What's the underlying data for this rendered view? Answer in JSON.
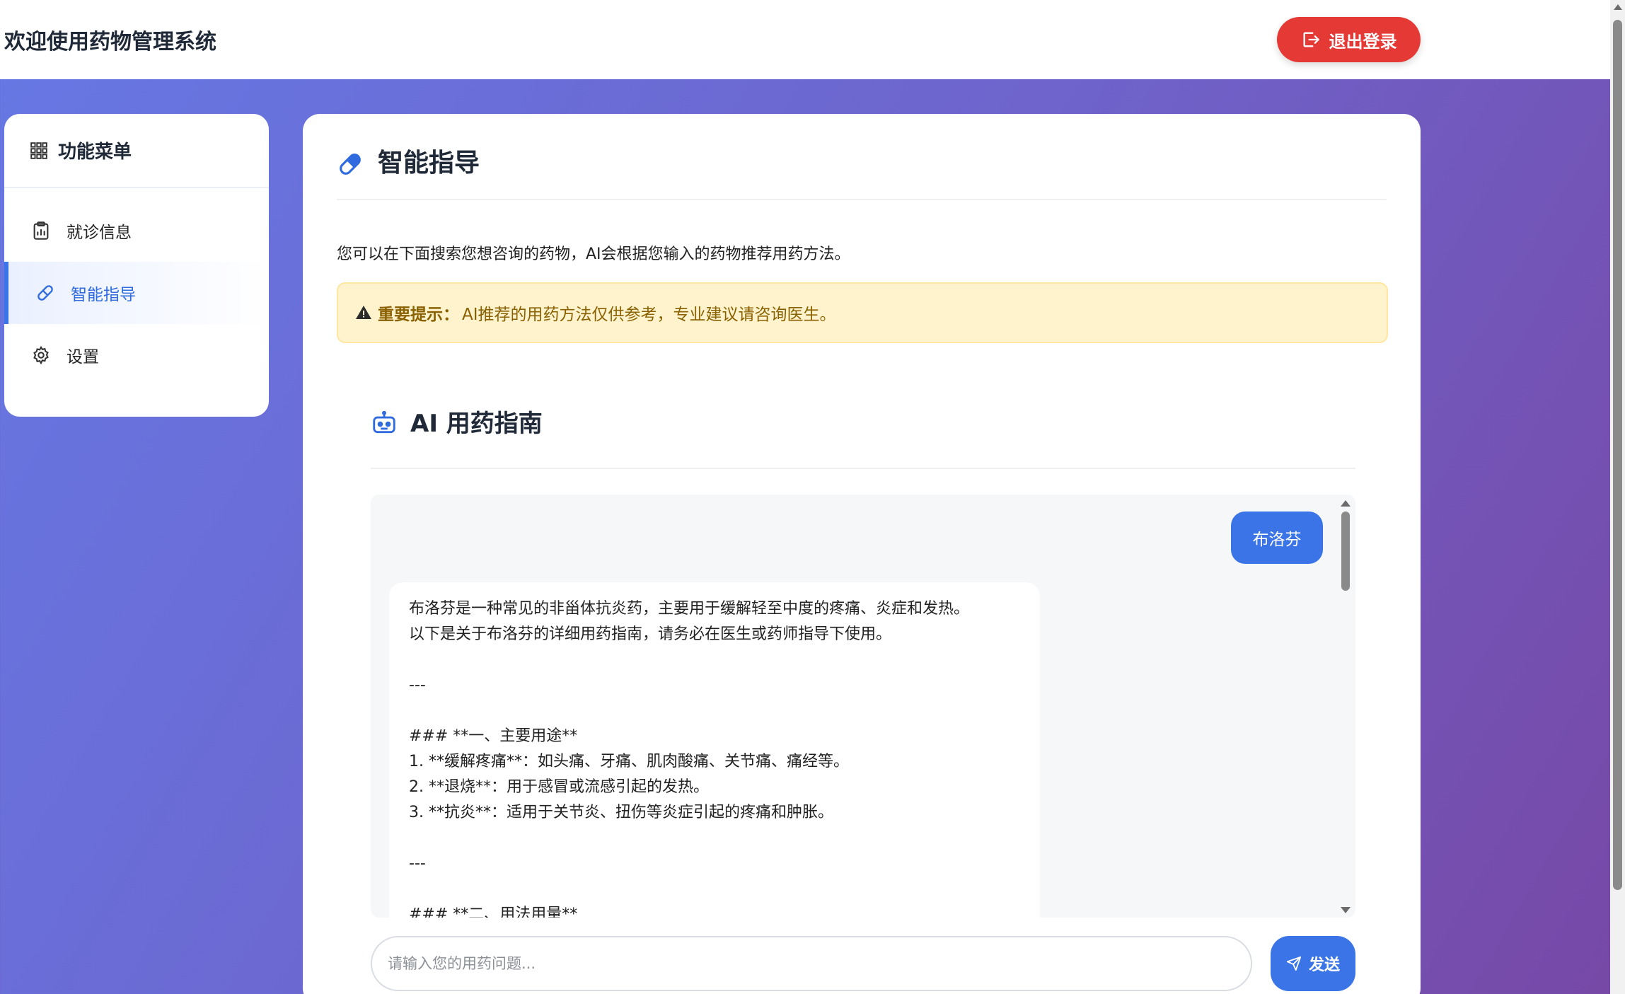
{
  "header": {
    "title": "欢迎使用药物管理系统",
    "logout_label": "退出登录",
    "logout_color": "#e53935"
  },
  "sidebar": {
    "title": "功能菜单",
    "items": [
      {
        "label": "就诊信息",
        "icon": "clipboard-icon",
        "active": false
      },
      {
        "label": "智能指导",
        "icon": "pill-icon",
        "active": true
      },
      {
        "label": "设置",
        "icon": "gear-icon",
        "active": false
      }
    ]
  },
  "main": {
    "title": "智能指导",
    "intro": "您可以在下面搜索您想咨询的药物，AI会根据您输入的药物推荐用药方法。",
    "notice": {
      "label": "重要提示：",
      "text": "AI推荐的用药方法仅供参考，专业建议请咨询医生。"
    },
    "ai_section_title": "AI 用药指南",
    "chat": {
      "user_message": "布洛芬",
      "ai_lines": [
        "布洛芬是一种常见的非甾体抗炎药，主要用于缓解轻至中度的疼痛、炎症和发热。",
        "以下是关于布洛芬的详细用药指南，请务必在医生或药师指导下使用。",
        "",
        "---",
        "",
        "### **一、主要用途**",
        "1. **缓解疼痛**：如头痛、牙痛、肌肉酸痛、关节痛、痛经等。",
        "2. **退烧**：用于感冒或流感引起的发热。",
        "3. **抗炎**：适用于关节炎、扭伤等炎症引起的疼痛和肿胀。",
        "",
        "---",
        "",
        "### **二、用法用量**"
      ]
    },
    "input_placeholder": "请输入您的用药问题...",
    "send_label": "发送",
    "accent_color": "#3a74e6"
  }
}
